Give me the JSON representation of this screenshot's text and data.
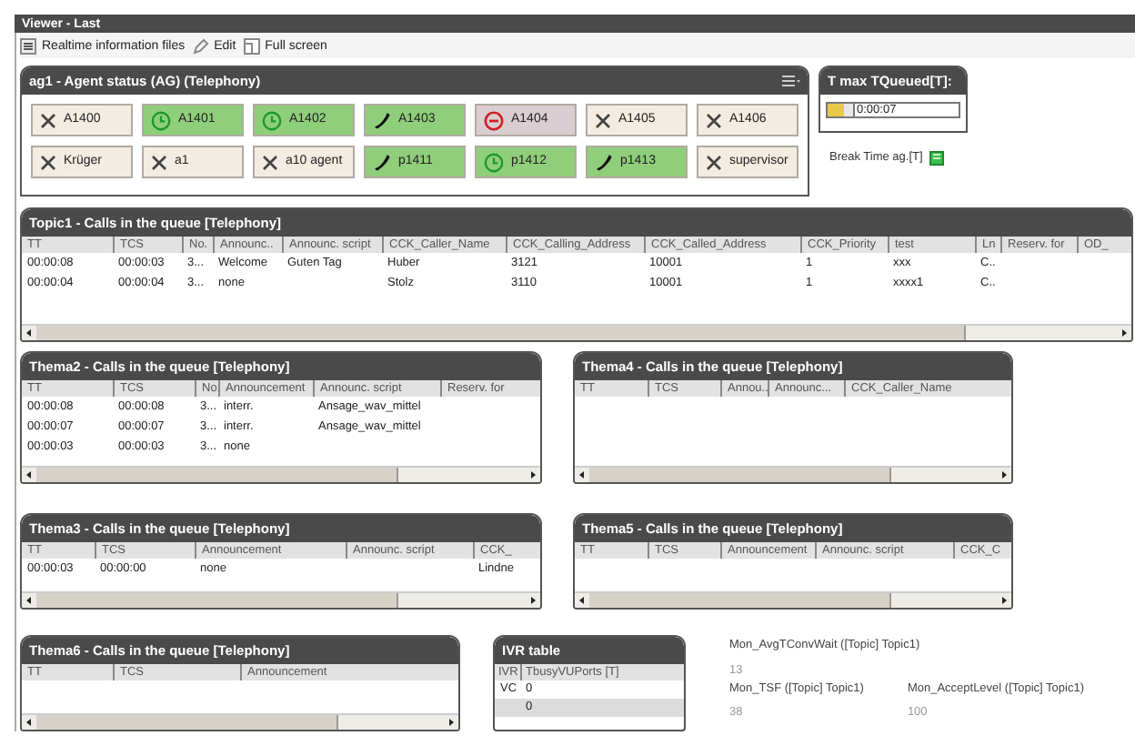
{
  "window": {
    "title": "Viewer - Last"
  },
  "toolbar": [
    {
      "label": "Realtime information files"
    },
    {
      "label": "Edit"
    },
    {
      "label": "Full screen"
    }
  ],
  "agent_panel": {
    "title": "ag1 - Agent status (AG) (Telephony)",
    "agents": [
      {
        "name": "A1400",
        "kind": "offline"
      },
      {
        "name": "A1401",
        "kind": "available"
      },
      {
        "name": "A1402",
        "kind": "available"
      },
      {
        "name": "A1403",
        "kind": "call"
      },
      {
        "name": "A1404",
        "kind": "blocked"
      },
      {
        "name": "A1405",
        "kind": "offline"
      },
      {
        "name": "A1406",
        "kind": "offline"
      },
      {
        "name": "Krüger",
        "kind": "offline"
      },
      {
        "name": "a1",
        "kind": "offline"
      },
      {
        "name": "a10 agent",
        "kind": "offline"
      },
      {
        "name": "p1411",
        "kind": "call"
      },
      {
        "name": "p1412",
        "kind": "available"
      },
      {
        "name": "p1413",
        "kind": "call"
      },
      {
        "name": "supervisor",
        "kind": "offline"
      }
    ]
  },
  "tmax": {
    "title": "T max TQueued[T]:",
    "level": 0.65,
    "value": "0:00:07"
  },
  "break_time": {
    "label": "Break Time ag.[T]"
  },
  "tables": [
    {
      "title": "Topic1 - Calls in the queue [Telephony]",
      "columns": [
        "TT",
        "TCS",
        "No.",
        "Announc..",
        "Announc. script",
        "CCK_Caller_Name",
        "CCK_Calling_Address",
        "CCK_Called_Address",
        "CCK_Priority",
        "test",
        "Ln",
        "Reserv. for",
        "OD_"
      ],
      "rows": [
        [
          "00:00:08",
          "00:00:03",
          "3...",
          "Welcome",
          "Guten Tag",
          "Huber",
          "3121",
          "10001",
          "1",
          "xxx",
          "C..",
          "",
          ""
        ],
        [
          "00:00:04",
          "00:00:04",
          "3...",
          "none",
          "",
          "Stolz",
          "3110",
          "10001",
          "1",
          "xxxx1",
          "C..",
          "",
          ""
        ]
      ]
    },
    {
      "title": "Thema2 - Calls in the queue [Telephony]",
      "columns": [
        "TT",
        "TCS",
        "No.",
        "Announcement",
        "Announc. script",
        "Reserv. for"
      ],
      "rows": [
        [
          "00:00:08",
          "00:00:08",
          "3...",
          "interr.",
          "Ansage_wav_mittel",
          ""
        ],
        [
          "00:00:07",
          "00:00:07",
          "3...",
          "interr.",
          "Ansage_wav_mittel",
          ""
        ],
        [
          "00:00:03",
          "00:00:03",
          "3...",
          "none",
          "",
          ""
        ]
      ]
    },
    {
      "title": "Thema4 - Calls in the queue [Telephony]",
      "columns": [
        "TT",
        "TCS",
        "Annou..",
        "Announc...",
        "CCK_Caller_Name"
      ]
    },
    {
      "title": "Thema3 - Calls in the queue [Telephony]",
      "columns": [
        "TT",
        "TCS",
        "Announcement",
        "Announc. script",
        "CCK_"
      ],
      "rows": [
        [
          "00:00:03",
          "00:00:00",
          "none",
          "",
          "Lindne"
        ]
      ]
    },
    {
      "title": "Thema5 - Calls in the queue [Telephony]",
      "columns": [
        "TT",
        "TCS",
        "Announcement",
        "Announc. script",
        "CCK_C"
      ]
    },
    {
      "title": "Thema6 - Calls in the queue [Telephony]",
      "columns": [
        "TT",
        "TCS",
        "Announcement",
        ""
      ]
    }
  ],
  "ivr_table": {
    "title": "IVR table",
    "columns": [
      "IVR",
      "TbusyVUPorts [T]"
    ],
    "rows": [
      {
        "kind": "data",
        "cells": [
          "VC",
          "0"
        ]
      },
      {
        "kind": "total",
        "cells": [
          "",
          "0"
        ]
      }
    ]
  },
  "metrics": [
    {
      "label": "Mon_AvgTConvWait ([Topic] Topic1)",
      "value": "13"
    },
    {
      "label": "Mon_TSF ([Topic] Topic1)",
      "value": "38"
    },
    {
      "label": "Mon_AcceptLevel ([Topic] Topic1)",
      "value": "100"
    }
  ]
}
